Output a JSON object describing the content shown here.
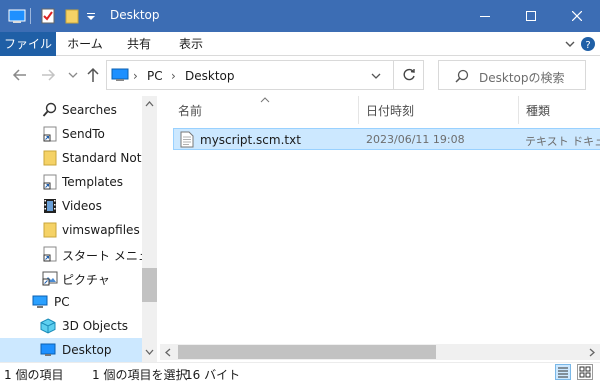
{
  "window": {
    "title": "Desktop"
  },
  "ribbon": {
    "tabs": [
      "ファイル",
      "ホーム",
      "共有",
      "表示"
    ]
  },
  "address": {
    "crumbs": [
      "PC",
      "Desktop"
    ],
    "search_placeholder": "Desktopの検索"
  },
  "nav": {
    "items": [
      {
        "label": "Searches",
        "icon": "search-icon"
      },
      {
        "label": "SendTo",
        "icon": "shortcut-folder-icon"
      },
      {
        "label": "Standard Notes",
        "icon": "folder-icon"
      },
      {
        "label": "Templates",
        "icon": "shortcut-folder-icon"
      },
      {
        "label": "Videos",
        "icon": "video-folder-icon"
      },
      {
        "label": "vimswapfiles",
        "icon": "folder-icon"
      },
      {
        "label": "スタート メニュー",
        "icon": "shortcut-folder-icon"
      },
      {
        "label": "ピクチャ",
        "icon": "shortcut-folder-icon"
      },
      {
        "label": "PC",
        "icon": "computer-icon"
      },
      {
        "label": "3D Objects",
        "icon": "3d-objects-icon"
      },
      {
        "label": "Desktop",
        "icon": "desktop-icon"
      }
    ]
  },
  "columns": {
    "name": "名前",
    "date": "日付時刻",
    "type": "種類"
  },
  "files": [
    {
      "name": "myscript.scm.txt",
      "date": "2023/06/11 19:08",
      "type": "テキスト ドキュメント"
    }
  ],
  "status": {
    "count": "1 個の項目",
    "selected": "1 個の項目を選択",
    "size": "16 バイト"
  },
  "colors": {
    "titlebar": "#3c6db4",
    "file_tab": "#1f5fa6",
    "selection": "#cce8ff",
    "folder": "#f5d266"
  }
}
